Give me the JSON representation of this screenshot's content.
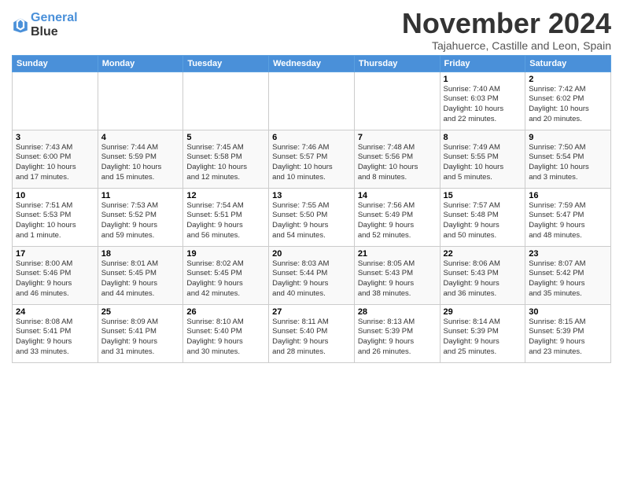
{
  "logo": {
    "line1": "General",
    "line2": "Blue"
  },
  "title": "November 2024",
  "subtitle": "Tajahuerce, Castille and Leon, Spain",
  "days_of_week": [
    "Sunday",
    "Monday",
    "Tuesday",
    "Wednesday",
    "Thursday",
    "Friday",
    "Saturday"
  ],
  "weeks": [
    [
      {
        "day": "",
        "info": ""
      },
      {
        "day": "",
        "info": ""
      },
      {
        "day": "",
        "info": ""
      },
      {
        "day": "",
        "info": ""
      },
      {
        "day": "",
        "info": ""
      },
      {
        "day": "1",
        "info": "Sunrise: 7:40 AM\nSunset: 6:03 PM\nDaylight: 10 hours\nand 22 minutes."
      },
      {
        "day": "2",
        "info": "Sunrise: 7:42 AM\nSunset: 6:02 PM\nDaylight: 10 hours\nand 20 minutes."
      }
    ],
    [
      {
        "day": "3",
        "info": "Sunrise: 7:43 AM\nSunset: 6:00 PM\nDaylight: 10 hours\nand 17 minutes."
      },
      {
        "day": "4",
        "info": "Sunrise: 7:44 AM\nSunset: 5:59 PM\nDaylight: 10 hours\nand 15 minutes."
      },
      {
        "day": "5",
        "info": "Sunrise: 7:45 AM\nSunset: 5:58 PM\nDaylight: 10 hours\nand 12 minutes."
      },
      {
        "day": "6",
        "info": "Sunrise: 7:46 AM\nSunset: 5:57 PM\nDaylight: 10 hours\nand 10 minutes."
      },
      {
        "day": "7",
        "info": "Sunrise: 7:48 AM\nSunset: 5:56 PM\nDaylight: 10 hours\nand 8 minutes."
      },
      {
        "day": "8",
        "info": "Sunrise: 7:49 AM\nSunset: 5:55 PM\nDaylight: 10 hours\nand 5 minutes."
      },
      {
        "day": "9",
        "info": "Sunrise: 7:50 AM\nSunset: 5:54 PM\nDaylight: 10 hours\nand 3 minutes."
      }
    ],
    [
      {
        "day": "10",
        "info": "Sunrise: 7:51 AM\nSunset: 5:53 PM\nDaylight: 10 hours\nand 1 minute."
      },
      {
        "day": "11",
        "info": "Sunrise: 7:53 AM\nSunset: 5:52 PM\nDaylight: 9 hours\nand 59 minutes."
      },
      {
        "day": "12",
        "info": "Sunrise: 7:54 AM\nSunset: 5:51 PM\nDaylight: 9 hours\nand 56 minutes."
      },
      {
        "day": "13",
        "info": "Sunrise: 7:55 AM\nSunset: 5:50 PM\nDaylight: 9 hours\nand 54 minutes."
      },
      {
        "day": "14",
        "info": "Sunrise: 7:56 AM\nSunset: 5:49 PM\nDaylight: 9 hours\nand 52 minutes."
      },
      {
        "day": "15",
        "info": "Sunrise: 7:57 AM\nSunset: 5:48 PM\nDaylight: 9 hours\nand 50 minutes."
      },
      {
        "day": "16",
        "info": "Sunrise: 7:59 AM\nSunset: 5:47 PM\nDaylight: 9 hours\nand 48 minutes."
      }
    ],
    [
      {
        "day": "17",
        "info": "Sunrise: 8:00 AM\nSunset: 5:46 PM\nDaylight: 9 hours\nand 46 minutes."
      },
      {
        "day": "18",
        "info": "Sunrise: 8:01 AM\nSunset: 5:45 PM\nDaylight: 9 hours\nand 44 minutes."
      },
      {
        "day": "19",
        "info": "Sunrise: 8:02 AM\nSunset: 5:45 PM\nDaylight: 9 hours\nand 42 minutes."
      },
      {
        "day": "20",
        "info": "Sunrise: 8:03 AM\nSunset: 5:44 PM\nDaylight: 9 hours\nand 40 minutes."
      },
      {
        "day": "21",
        "info": "Sunrise: 8:05 AM\nSunset: 5:43 PM\nDaylight: 9 hours\nand 38 minutes."
      },
      {
        "day": "22",
        "info": "Sunrise: 8:06 AM\nSunset: 5:43 PM\nDaylight: 9 hours\nand 36 minutes."
      },
      {
        "day": "23",
        "info": "Sunrise: 8:07 AM\nSunset: 5:42 PM\nDaylight: 9 hours\nand 35 minutes."
      }
    ],
    [
      {
        "day": "24",
        "info": "Sunrise: 8:08 AM\nSunset: 5:41 PM\nDaylight: 9 hours\nand 33 minutes."
      },
      {
        "day": "25",
        "info": "Sunrise: 8:09 AM\nSunset: 5:41 PM\nDaylight: 9 hours\nand 31 minutes."
      },
      {
        "day": "26",
        "info": "Sunrise: 8:10 AM\nSunset: 5:40 PM\nDaylight: 9 hours\nand 30 minutes."
      },
      {
        "day": "27",
        "info": "Sunrise: 8:11 AM\nSunset: 5:40 PM\nDaylight: 9 hours\nand 28 minutes."
      },
      {
        "day": "28",
        "info": "Sunrise: 8:13 AM\nSunset: 5:39 PM\nDaylight: 9 hours\nand 26 minutes."
      },
      {
        "day": "29",
        "info": "Sunrise: 8:14 AM\nSunset: 5:39 PM\nDaylight: 9 hours\nand 25 minutes."
      },
      {
        "day": "30",
        "info": "Sunrise: 8:15 AM\nSunset: 5:39 PM\nDaylight: 9 hours\nand 23 minutes."
      }
    ]
  ]
}
